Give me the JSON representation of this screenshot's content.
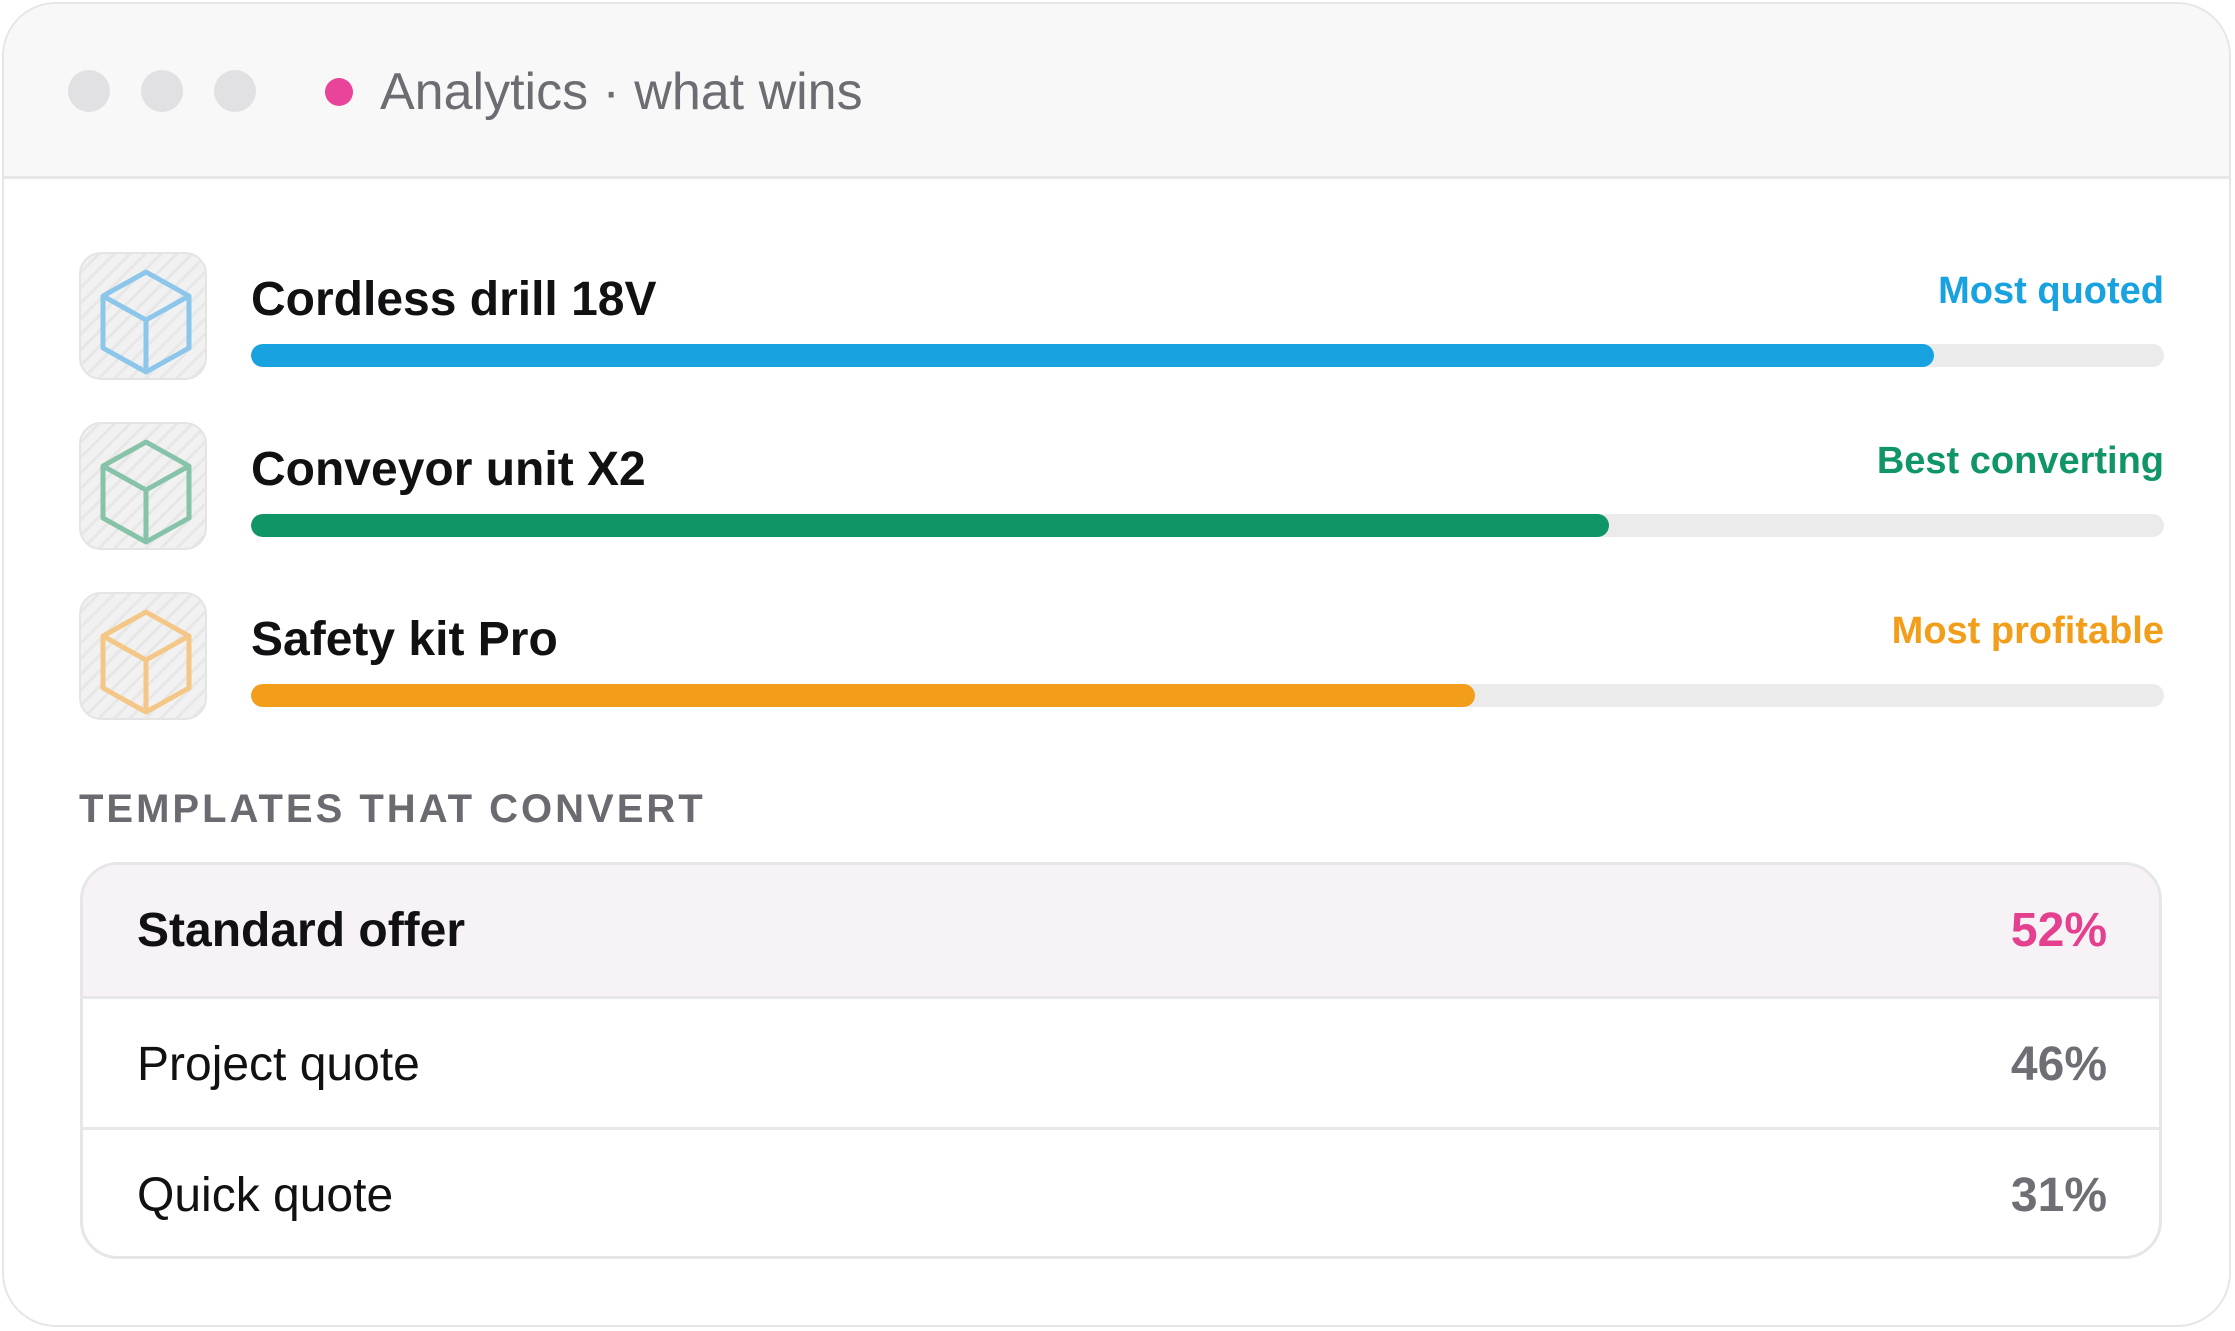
{
  "window": {
    "title": "Analytics · what wins",
    "status_color": "#e8449a"
  },
  "products": [
    {
      "name": "Cordless drill 18V",
      "tag": "Most quoted",
      "color": "#18a2e0",
      "icon_color": "#8cc6ea",
      "icon": "box-icon",
      "bar_fraction": 0.88
    },
    {
      "name": "Conveyor unit X2",
      "tag": "Best converting",
      "color": "#109566",
      "icon_color": "#86c3a8",
      "icon": "box-icon",
      "bar_fraction": 0.71
    },
    {
      "name": "Safety kit Pro",
      "tag": "Most profitable",
      "color": "#f29e1a",
      "icon_color": "#f4c786",
      "icon": "box-icon",
      "bar_fraction": 0.64
    }
  ],
  "templates": {
    "heading": "TEMPLATES THAT CONVERT",
    "rows": [
      {
        "name": "Standard offer",
        "value": "52%",
        "highlighted": true
      },
      {
        "name": "Project quote",
        "value": "46%",
        "highlighted": false
      },
      {
        "name": "Quick quote",
        "value": "31%",
        "highlighted": false
      }
    ]
  }
}
